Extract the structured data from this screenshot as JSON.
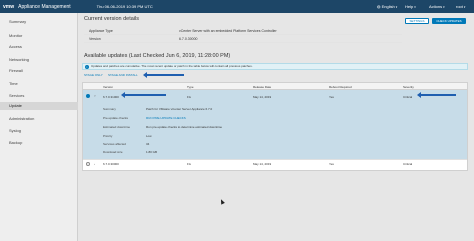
{
  "header": {
    "logo": "vmw",
    "app_title": "Appliance Management",
    "datetime": "Thu 06-06-2019 10:39 PM UTC",
    "menus": [
      {
        "label": "English",
        "icon": "globe-icon"
      },
      {
        "label": "Help"
      },
      {
        "label": "Actions"
      },
      {
        "label": "root"
      }
    ]
  },
  "sidebar": {
    "items": [
      {
        "label": "Summary"
      },
      {
        "label": "Monitor"
      },
      {
        "label": "Access"
      },
      {
        "label": "Networking"
      },
      {
        "label": "Firewall"
      },
      {
        "label": "Time"
      },
      {
        "label": "Services"
      },
      {
        "label": "Update",
        "active": true
      },
      {
        "label": "Administration"
      },
      {
        "label": "Syslog"
      },
      {
        "label": "Backup"
      }
    ]
  },
  "current_version": {
    "title": "Current version details",
    "rows": [
      {
        "label": "Appliance Type",
        "value": "vCenter Server with an embedded Platform Services Controller"
      },
      {
        "label": "Version",
        "value": "6.7.0.30000"
      }
    ],
    "settings_button": "SETTINGS",
    "check_updates_button": "CHECK UPDATES"
  },
  "updates": {
    "title": "Available updates (Last Checked Jun 6, 2019, 11:28:00 PM)",
    "banner": "Updates and patches are cumulative. The most recent update or patch in the table below will contain all previous patches.",
    "links": [
      "STAGE ONLY",
      "STAGE AND INSTALL"
    ],
    "columns": [
      "Version",
      "Type",
      "Release Date",
      "Reboot Required",
      "Severity"
    ],
    "rows": [
      {
        "version": "6.7.0.31000",
        "type": "Fix",
        "release_date": "May 14, 2019",
        "reboot": "Yes",
        "severity": "Critical",
        "selected": true
      },
      {
        "version": "6.7.0.30000",
        "type": "Fix",
        "release_date": "May 14, 2019",
        "reboot": "Yes",
        "severity": "Critical",
        "selected": false
      }
    ],
    "details": [
      {
        "label": "Summary",
        "value": "Patch for VMware vCenter Server Appliance 6.7.0"
      },
      {
        "label": "Pre-update checks",
        "value": "RUN PRE-UPDATE CHECKS",
        "link": true
      },
      {
        "label": "Estimated downtime",
        "value": "Run pre-update checks to determine estimated downtime"
      },
      {
        "label": "Priority",
        "value": "Low"
      },
      {
        "label": "Services affected",
        "value": "34"
      },
      {
        "label": "Download size",
        "value": "1.80 GB"
      }
    ]
  },
  "colors": {
    "header_bg": "#1d4667",
    "accent": "#0079b8",
    "selected_row": "#c7dce8",
    "annotation_arrow": "#1f5fb0"
  }
}
